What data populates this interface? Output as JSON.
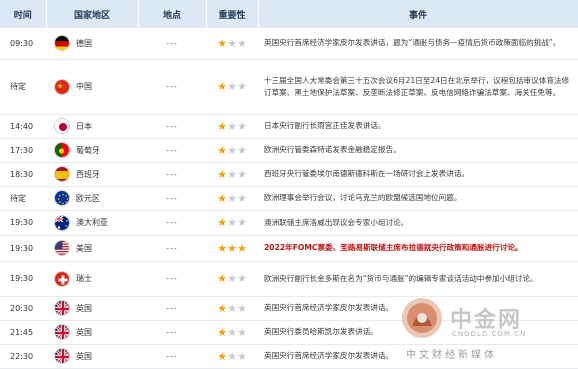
{
  "header": {
    "time": "时间",
    "country": "国家地区",
    "place": "地点",
    "importance": "重要性",
    "event": "事件"
  },
  "rows": [
    {
      "time": "09:30",
      "country": "德国",
      "flag": "flag-germany",
      "place": "---",
      "stars": 1,
      "event": "英国央行首席经济学家皮尔发表讲话，题为“通胀与债务—疫情后货币政策面临的挑战”。",
      "highlight": false
    },
    {
      "time": "待定",
      "country": "中国",
      "flag": "flag-china",
      "place": "---",
      "stars": 1,
      "event": "十三届全国人大常委会第三十五次会议6月21日至24日在北京举行，议程包括审议体育法修订草案、黑土地保护法草案、反垄断法修正草案、反电信网络诈骗法草案、海关任免等。",
      "highlight": false
    },
    {
      "time": "14:40",
      "country": "日本",
      "flag": "flag-japan",
      "place": "---",
      "stars": 1,
      "event": "日本央行副行长雨宫正佳发表讲话。",
      "highlight": false
    },
    {
      "time": "17:30",
      "country": "葡萄牙",
      "flag": "flag-portugal",
      "place": "---",
      "stars": 1,
      "event": "欧洲央行管委森特诺发表金融稳定报告。",
      "highlight": false
    },
    {
      "time": "18:30",
      "country": "西班牙",
      "flag": "flag-spain",
      "place": "---",
      "stars": 1,
      "event": "西班牙央行管委埃尔南德斯德科斯在一场研讨会上发表讲话。",
      "highlight": false
    },
    {
      "time": "待定",
      "country": "欧元区",
      "flag": "flag-eu",
      "place": "---",
      "stars": 1,
      "event": "欧洲理事会举行会议，讨论乌克兰的欧盟候选国地位问题。",
      "highlight": false
    },
    {
      "time": "19:30",
      "country": "澳大利亚",
      "flag": "flag-australia",
      "place": "---",
      "stars": 1,
      "event": "澳洲联储主席洛威出现议会专家小组讨论。",
      "highlight": false
    },
    {
      "time": "19:30",
      "country": "美国",
      "flag": "flag-usa",
      "place": "---",
      "stars": 3,
      "event": "2022年FOMC票委、圣路易斯联储主席布拉德就央行政策和通胀进行讨论。",
      "highlight": true
    },
    {
      "time": "19:30",
      "country": "瑞士",
      "flag": "flag-switzerland",
      "place": "---",
      "stars": 1,
      "event": "欧洲央行副行长金多斯在名为“货币与通胀”的编辑专家谈话活动中参加小组讨论。",
      "highlight": false
    },
    {
      "time": "20:30",
      "country": "英国",
      "flag": "flag-uk",
      "place": "---",
      "stars": 1,
      "event": "英国央行首席经济学家皮尔发表讲话。",
      "highlight": false
    },
    {
      "time": "21:45",
      "country": "英国",
      "flag": "flag-uk",
      "place": "---",
      "stars": 1,
      "event": "英国央行委员哈斯凯尔发表讲话。",
      "highlight": false
    },
    {
      "time": "22:30",
      "country": "英国",
      "flag": "flag-uk",
      "place": "---",
      "stars": 1,
      "event": "英国央行首席经济学家皮尔发表讲话。",
      "highlight": false
    }
  ],
  "watermark": {
    "title": "中金网",
    "url": "CNGOLD.COM.CN",
    "slogan": "中文财经新媒体"
  },
  "colors": {
    "header_bg": "#dde9f6",
    "star_on": "#f2a10b",
    "star_off": "#c8c8c8",
    "highlight": "#c01414"
  }
}
